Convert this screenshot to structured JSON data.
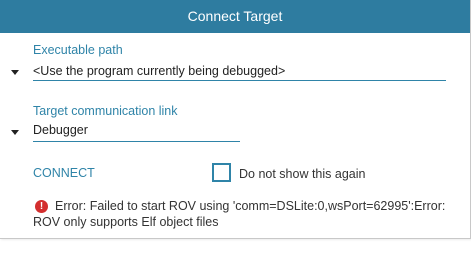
{
  "dialog": {
    "title": "Connect Target",
    "title_bar_color": "#2e7ca0",
    "accent_color": "#2f84a8",
    "executable": {
      "label": "Executable path",
      "value": "<Use the program currently being debugged>",
      "icon": "dropdown-arrow-icon"
    },
    "link": {
      "label": "Target communication link",
      "value": "Debugger",
      "icon": "dropdown-arrow-icon"
    },
    "connect_label": "CONNECT",
    "checkbox": {
      "label": "Do not show this again",
      "checked": false
    },
    "error": {
      "icon": "error-icon",
      "icon_glyph": "!",
      "color": "#d32f2f",
      "message": "Error: Failed to start ROV using 'comm=DSLite:0,wsPort=62995':Error: ROV only supports Elf object files"
    }
  }
}
